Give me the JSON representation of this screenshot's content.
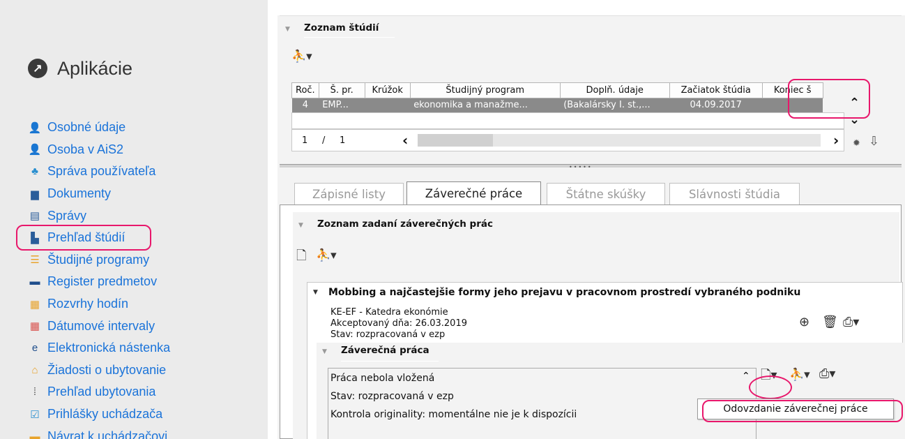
{
  "sidebar": {
    "title": "Aplikácie",
    "title_icon": "arrow-circle-icon",
    "items": [
      {
        "label": "Osobné údaje",
        "icon": "person-icon",
        "glyph": "👤",
        "color": "#c0392b"
      },
      {
        "label": "Osoba v AiS2",
        "icon": "person-icon",
        "glyph": "👤",
        "color": "#c0392b"
      },
      {
        "label": "Správa používateľa",
        "icon": "org-tree-icon",
        "glyph": "♣",
        "color": "#2a8fcf"
      },
      {
        "label": "Dokumenty",
        "icon": "document-icon",
        "glyph": "▆",
        "color": "#2a5d9a"
      },
      {
        "label": "Správy",
        "icon": "message-icon",
        "glyph": "▤",
        "color": "#2a5d9a"
      },
      {
        "label": "Prehľad štúdií",
        "icon": "studies-icon",
        "glyph": "▙",
        "color": "#2a5d9a"
      },
      {
        "label": "Študijné programy",
        "icon": "list-icon",
        "glyph": "☰",
        "color": "#e8a32b"
      },
      {
        "label": "Register predmetov",
        "icon": "briefcase-icon",
        "glyph": "▬",
        "color": "#1f4e8c"
      },
      {
        "label": "Rozvrhy hodín",
        "icon": "calendar-icon",
        "glyph": "▦",
        "color": "#e8a32b"
      },
      {
        "label": "Dátumové intervaly",
        "icon": "calendar-icon",
        "glyph": "▦",
        "color": "#d9534f"
      },
      {
        "label": "Elektronická nástenka",
        "icon": "e-board-icon",
        "glyph": "e",
        "color": "#1f4e8c"
      },
      {
        "label": "Žiadosti o ubytovanie",
        "icon": "accommodation-icon",
        "glyph": "⌂",
        "color": "#e8a32b"
      },
      {
        "label": "Prehľad ubytovania",
        "icon": "grid-dots-icon",
        "glyph": "⁞",
        "color": "#555555"
      },
      {
        "label": "Prihlášky uchádzača",
        "icon": "checkbox-icon",
        "glyph": "☑",
        "color": "#2a8fcf"
      },
      {
        "label": "Návrat k uchádzačovi",
        "icon": "arrow-icon",
        "glyph": "▬",
        "color": "#e8a32b"
      }
    ]
  },
  "studies": {
    "section_title": "Zoznam štúdií",
    "columns": [
      "Roč.",
      "Š. pr.",
      "Krúžok",
      "Študijný program",
      "Doplň. údaje",
      "Začiatok štúdia",
      "Koniec š"
    ],
    "rows": [
      [
        "4",
        "EMP...",
        "",
        "ekonomika a manažme...",
        "(Bakalársky I. st.,...",
        "04.09.2017",
        ""
      ]
    ],
    "pager": {
      "current": "1",
      "sep": "/",
      "total": "1"
    }
  },
  "tabs": [
    {
      "label": "Zápisné listy",
      "active": false
    },
    {
      "label": "Záverečné práce",
      "active": true
    },
    {
      "label": "Štátne skúšky",
      "active": false
    },
    {
      "label": "Slávnosti štúdia",
      "active": false
    }
  ],
  "theses": {
    "section_title": "Zoznam zadaní záverečných prác",
    "item": {
      "title": "Mobbing a najčastejšie formy jeho prejavu v pracovnom prostredí vybraného podniku",
      "department": "KE-EF - Katedra ekonómie",
      "accepted": "Akceptovaný dňa: 26.03.2019",
      "state": "Stav: rozpracovaná v ezp"
    },
    "work": {
      "section_title": "Záverečná práca",
      "lines": [
        "Práca nebola vložená",
        "Stav: rozpracovaná v ezp",
        "Kontrola originality: momentálne nie je k dispozícii"
      ]
    }
  },
  "tooltip": "Odovzdanie záverečnej práce",
  "highlight_color": "#e8176b"
}
